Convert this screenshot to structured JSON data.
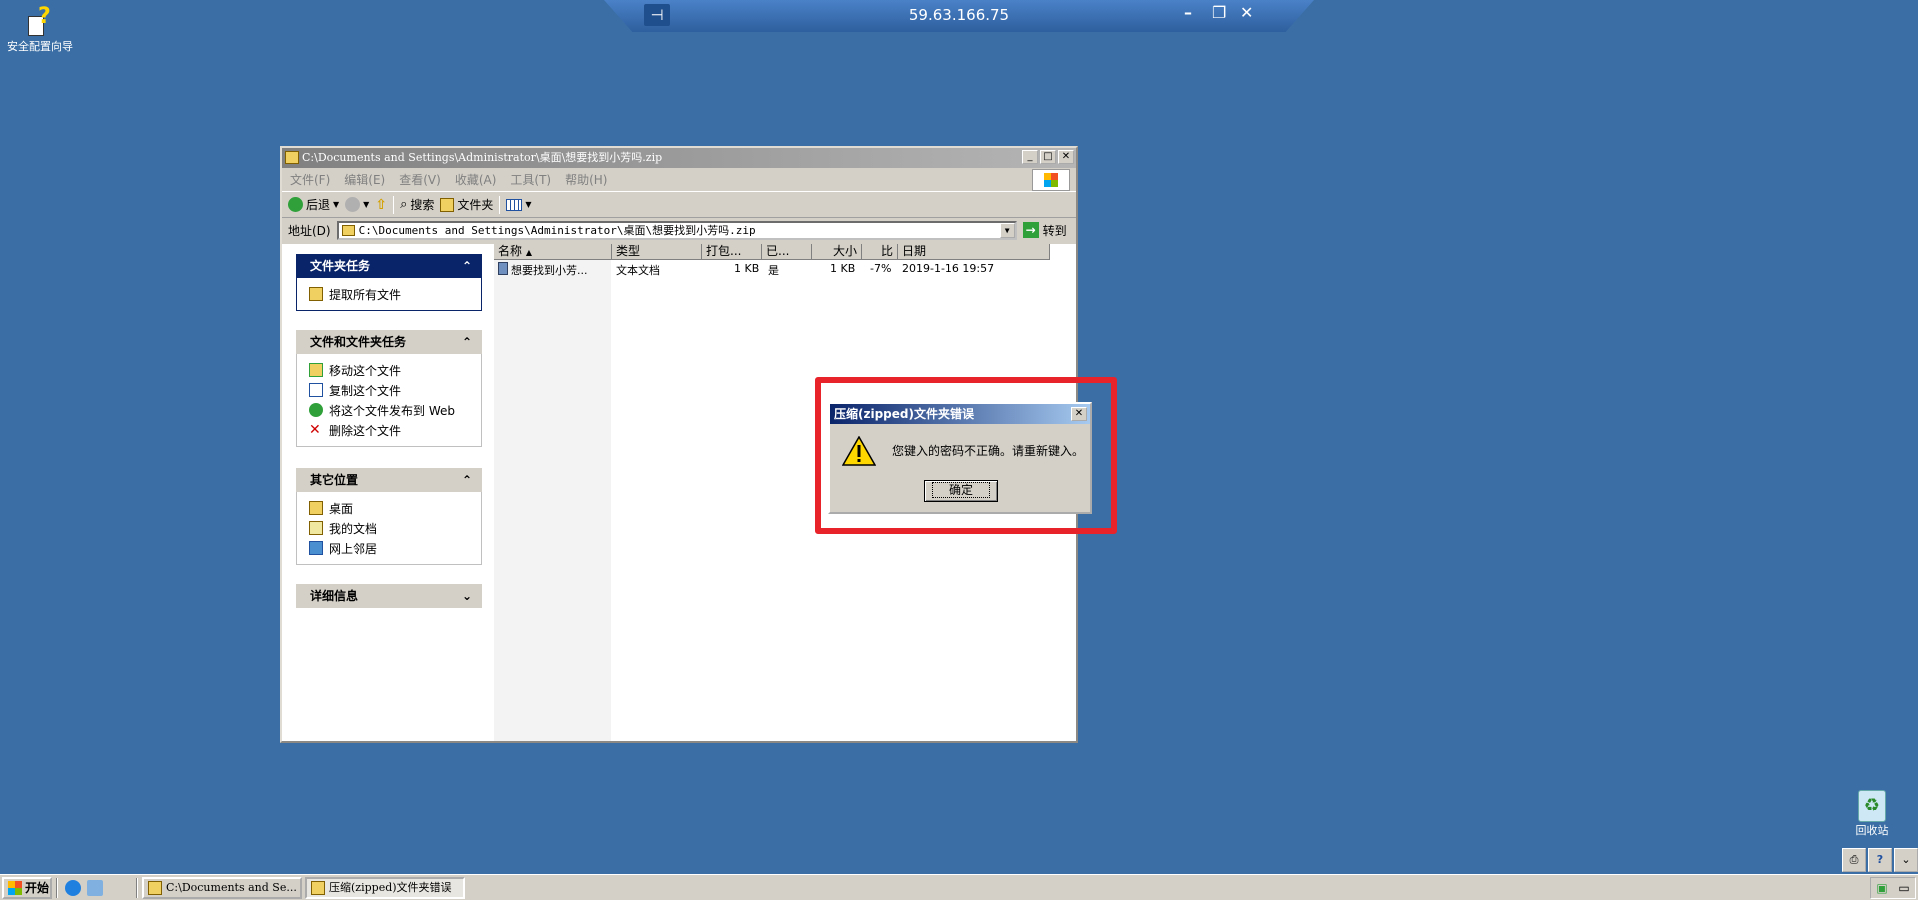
{
  "rdp": {
    "host": "59.63.166.75"
  },
  "desktop": {
    "icons": [
      {
        "label": "安全配置向导"
      },
      {
        "label": "回收站"
      }
    ]
  },
  "explorer": {
    "title": "C:\\Documents and Settings\\Administrator\\桌面\\想要找到小芳吗.zip",
    "menu": [
      "文件(F)",
      "编辑(E)",
      "查看(V)",
      "收藏(A)",
      "工具(T)",
      "帮助(H)"
    ],
    "toolbar": {
      "back": "后退",
      "search": "搜索",
      "folders": "文件夹"
    },
    "address": {
      "label": "地址(D)",
      "value": "C:\\Documents and Settings\\Administrator\\桌面\\想要找到小芳吗.zip",
      "go": "转到"
    },
    "sidebar": {
      "folder_tasks": {
        "title": "文件夹任务",
        "items": [
          "提取所有文件"
        ]
      },
      "file_tasks": {
        "title": "文件和文件夹任务",
        "items": [
          "移动这个文件",
          "复制这个文件",
          "将这个文件发布到 Web",
          "删除这个文件"
        ]
      },
      "other_places": {
        "title": "其它位置",
        "items": [
          "桌面",
          "我的文档",
          "网上邻居"
        ]
      },
      "details": {
        "title": "详细信息"
      }
    },
    "columns": [
      "名称",
      "类型",
      "打包...",
      "已...",
      "大小",
      "比",
      "日期"
    ],
    "files": [
      {
        "name": "想要找到小芳...",
        "type": "文本文档",
        "packed": "1 KB",
        "encrypted": "是",
        "size": "1 KB",
        "ratio": "-7%",
        "date": "2019-1-16 19:57"
      }
    ]
  },
  "dialog": {
    "title": "压缩(zipped)文件夹错误",
    "message": "您键入的密码不正确。请重新键入。",
    "ok": "确定"
  },
  "taskbar": {
    "start": "开始",
    "tasks": [
      {
        "label": "C:\\Documents and Se..."
      },
      {
        "label": "压缩(zipped)文件夹错误"
      }
    ]
  },
  "colors": {
    "desktop": "#3a6ea5",
    "highlight": "#e8232a",
    "active_title": "#0a246a"
  }
}
